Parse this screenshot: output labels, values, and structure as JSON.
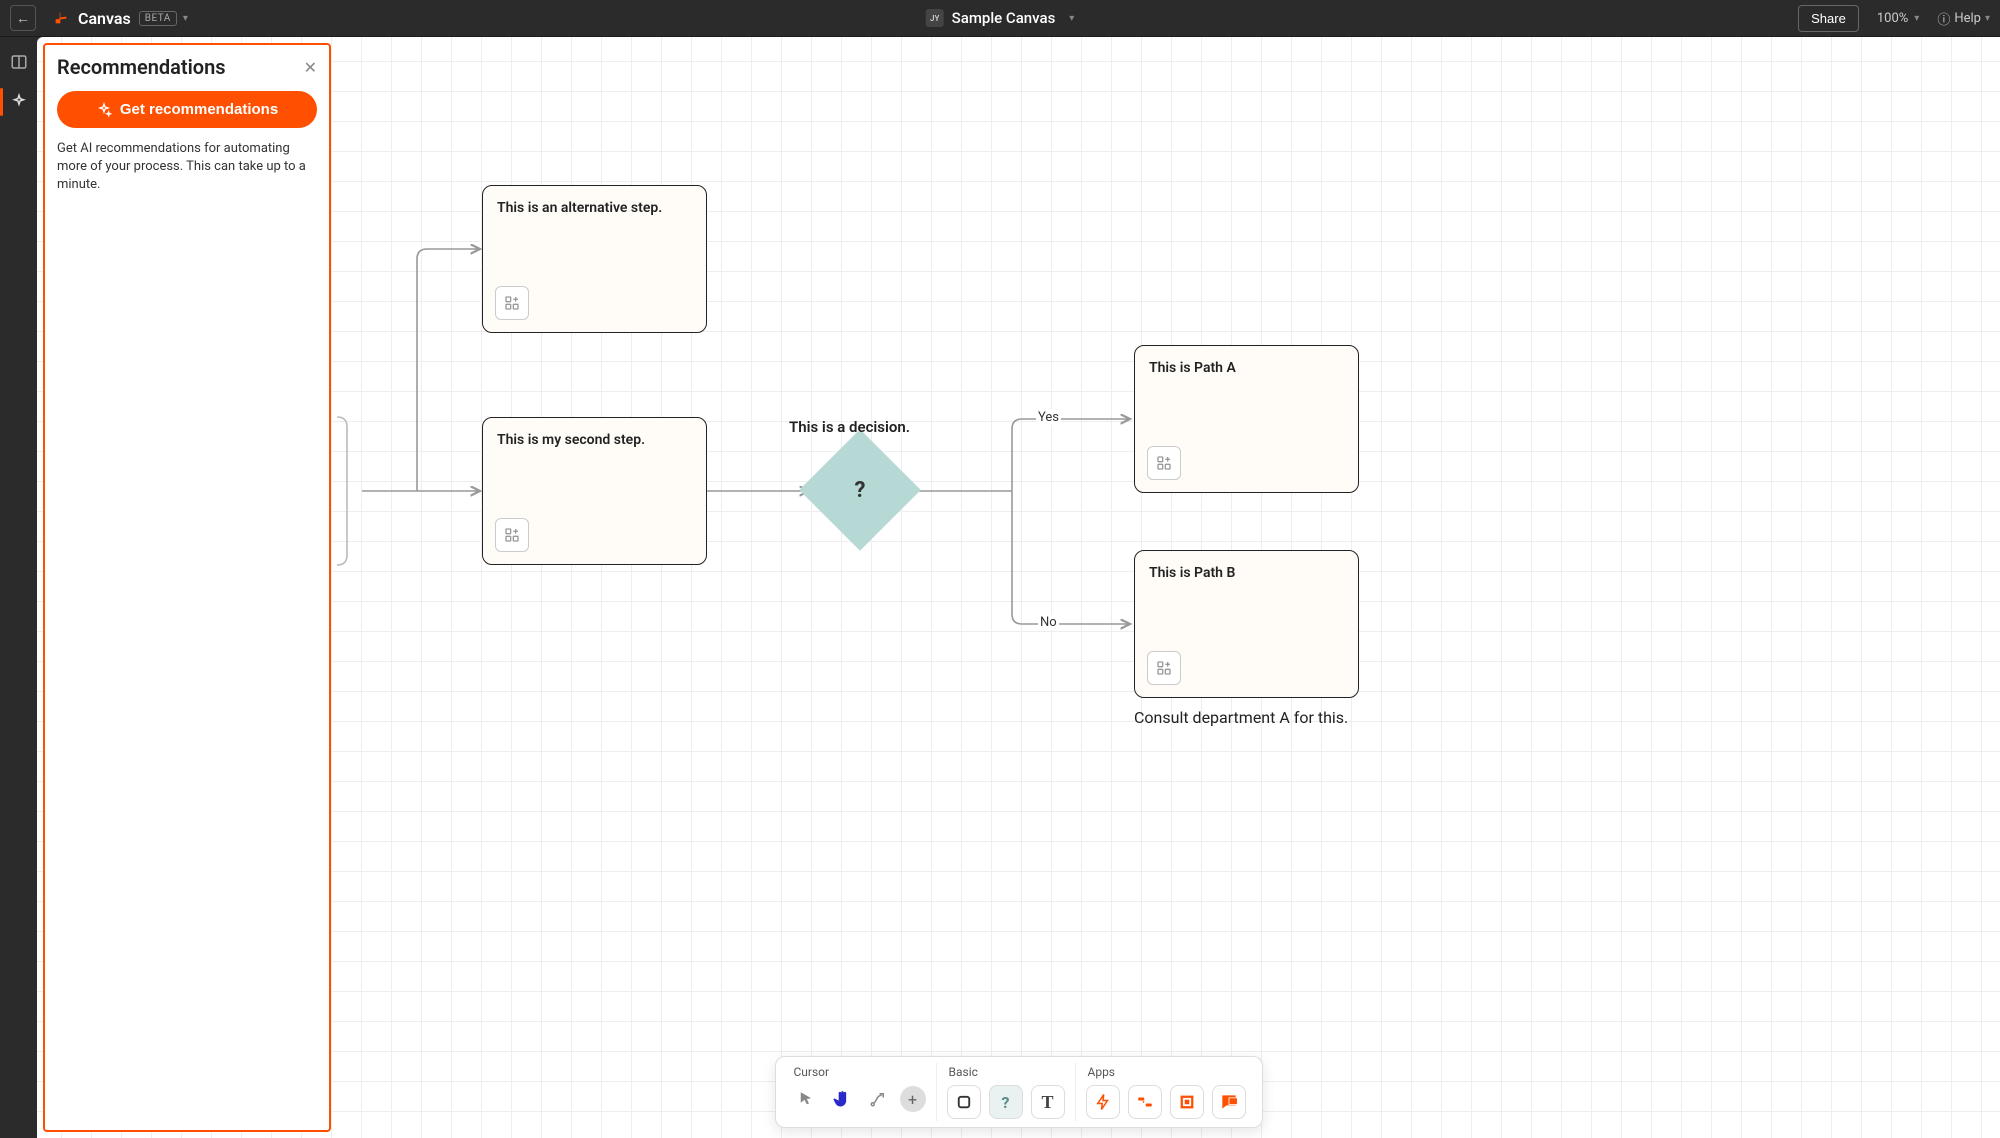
{
  "header": {
    "app_name": "Canvas",
    "beta": "BETA",
    "canvas_name": "Sample Canvas",
    "avatar": "JY",
    "share": "Share",
    "zoom": "100%",
    "help": "Help"
  },
  "panel": {
    "title": "Recommendations",
    "cta": "Get recommendations",
    "description": "Get AI recommendations for automating more of your process. This can take up to a minute."
  },
  "nodes": {
    "alt_step": "This is an alternative step.",
    "second_step": "This is my second step.",
    "decision_label": "This is a decision.",
    "decision_mark": "?",
    "path_a": "This is Path A",
    "path_b": "This is Path B",
    "path_b_caption": "Consult department A for this."
  },
  "edges": {
    "yes": "Yes",
    "no": "No"
  },
  "toolbox": {
    "cursor": "Cursor",
    "basic": "Basic",
    "apps": "Apps"
  }
}
